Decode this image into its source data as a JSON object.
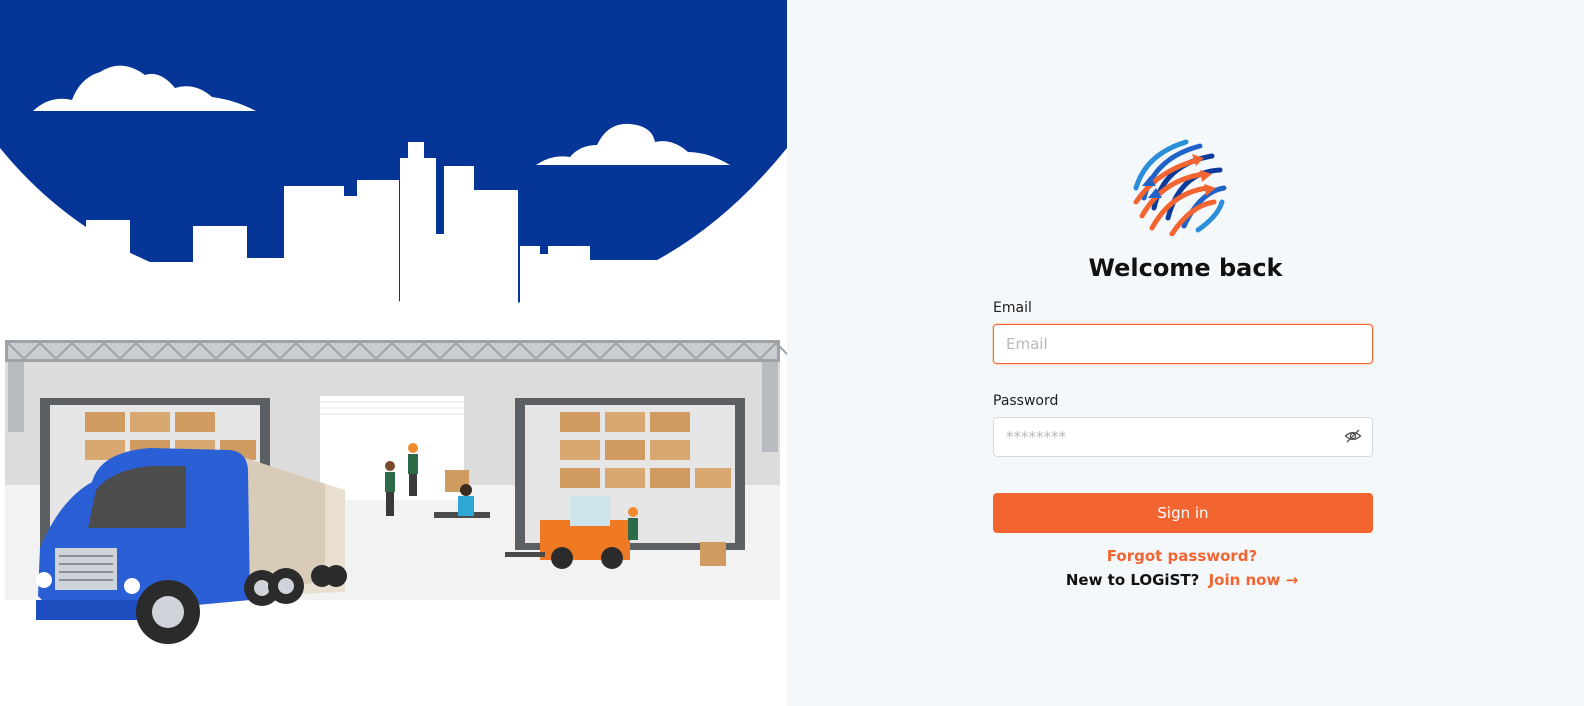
{
  "login": {
    "title": "Welcome back",
    "email_label": "Email",
    "email_placeholder": "Email",
    "email_value": "",
    "password_label": "Password",
    "password_placeholder": "********",
    "password_value": "",
    "sign_in_label": "Sign in",
    "forgot_label": "Forgot password?",
    "new_to_text": "New to LOGiST?",
    "join_label": "Join now",
    "join_arrow": "→"
  },
  "icons": {
    "logo": "logist-globe-arrows-logo",
    "password_toggle": "eye-slash-icon"
  },
  "colors": {
    "accent": "#f26430",
    "brand_blue": "#0a3a9c",
    "truck_blue": "#2b5fd6",
    "panel_bg": "#f5f8fb"
  }
}
